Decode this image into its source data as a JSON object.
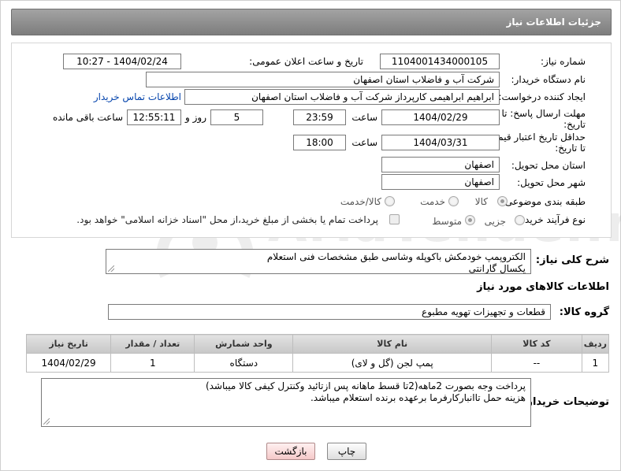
{
  "header": {
    "title": "جزئیات اطلاعات نیاز"
  },
  "fields": {
    "need_number_label": "شماره نیاز:",
    "need_number": "1104001434000105",
    "announce_label": "تاریخ و ساعت اعلان عمومی:",
    "announce_value": "1404/02/24 - 10:27",
    "buyer_org_label": "نام دستگاه خریدار:",
    "buyer_org": "شرکت آب و فاضلاب استان اصفهان",
    "creator_label": "ایجاد کننده درخواست:",
    "creator": "ابراهیم ابراهیمی کارپرداز شرکت آب و فاضلاب استان اصفهان",
    "contact_link": "اطلاعات تماس خریدار",
    "deadline_label_1": "مهلت ارسال پاسخ: تا",
    "deadline_label_2": "تاریخ:",
    "deadline_date": "1404/02/29",
    "time_label": "ساعت",
    "deadline_time": "23:59",
    "days_value": "5",
    "days_label": "روز و",
    "remaining_value": "12:55:11",
    "remaining_label": "ساعت باقی مانده",
    "validity_label_1": "حداقل تاریخ اعتبار قیمت:",
    "validity_label_2": "تا تاریخ:",
    "validity_date": "1404/03/31",
    "validity_time_label": "ساعت",
    "validity_time": "18:00",
    "province_label": "استان محل تحویل:",
    "province": "اصفهان",
    "city_label": "شهر محل تحویل:",
    "city": "اصفهان",
    "category_label": "طبقه بندی موضوعی:",
    "category_options": [
      "کالا",
      "خدمت",
      "کالا/خدمت"
    ],
    "process_label": "نوع فرآیند خرید :",
    "process_options": [
      "جزیی",
      "متوسط"
    ],
    "payment_note": "پرداخت تمام یا بخشی از مبلغ خرید،از محل \"اسناد خزانه اسلامی\" خواهد بود."
  },
  "description": {
    "label": "شرح کلی نیاز:",
    "lines": [
      "الکتروپمپ خودمکش باکوپله وشاسی طبق مشخصات فنی استعلام",
      "یکسال گارانتی"
    ]
  },
  "items_section": {
    "title": "اطلاعات کالاهای مورد نیاز",
    "group_label": "گروه کالا:",
    "group_value": "قطعات و تجهیزات تهویه مطبوع"
  },
  "table": {
    "headers": [
      "ردیف",
      "کد کالا",
      "نام کالا",
      "واحد شمارش",
      "تعداد / مقدار",
      "تاریخ نیاز"
    ],
    "rows": [
      [
        "1",
        "--",
        "پمپ لجن (گل و لای)",
        "دستگاه",
        "1",
        "1404/02/29"
      ]
    ]
  },
  "buyer_notes": {
    "label": "توضیحات خریدار:",
    "lines": [
      "پرداخت وجه بصورت 2ماهه(2تا قسط ماهانه پس ازتائید وکنترل کیفی کالا میباشد)",
      "هزینه حمل تاانبارکارفرما برعهده برنده استعلام میباشد."
    ]
  },
  "buttons": {
    "print": "چاپ",
    "back": "بازگشت"
  },
  "watermark": {
    "text": "AriaTender.neT"
  }
}
